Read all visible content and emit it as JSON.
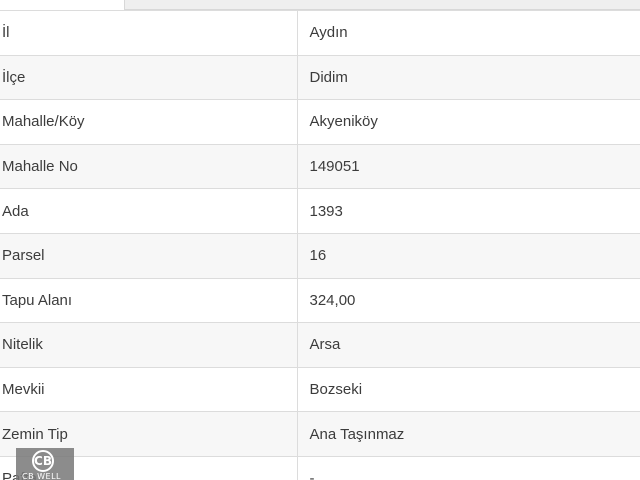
{
  "rows": [
    {
      "label": "İl",
      "value": "Aydın"
    },
    {
      "label": "İlçe",
      "value": "Didim"
    },
    {
      "label": "Mahalle/Köy",
      "value": "Akyeniköy"
    },
    {
      "label": "Mahalle No",
      "value": "149051"
    },
    {
      "label": "Ada",
      "value": "1393"
    },
    {
      "label": "Parsel",
      "value": "16"
    },
    {
      "label": "Tapu Alanı",
      "value": "324,00"
    },
    {
      "label": "Nitelik",
      "value": "Arsa"
    },
    {
      "label": "Mevkii",
      "value": "Bozseki"
    },
    {
      "label": "Zemin Tip",
      "value": "Ana Taşınmaz"
    },
    {
      "label": "Pafta",
      "value": "-"
    }
  ],
  "watermark": {
    "logo_text": "CB",
    "brand_text": "CB WELL"
  }
}
